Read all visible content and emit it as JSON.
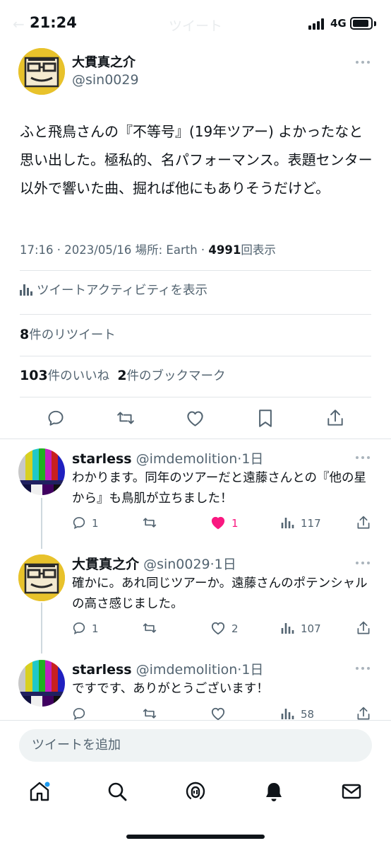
{
  "status_bar": {
    "time": "21:24",
    "network": "4G",
    "ghost_title": "ツイート"
  },
  "tweet": {
    "author_name": "大貫真之介",
    "author_handle": "@sin0029",
    "text": "ふと飛鳥さんの『不等号』(19年ツアー) よかったなと思い出した。極私的、名パフォーマンス。表題センター以外で響いた曲、掘れば他にもありそうだけど。",
    "meta_prefix": "17:16 · 2023/05/16 場所: Earth · ",
    "views": "4991",
    "views_label": "回表示",
    "activity_label": "ツイートアクティビティを表示",
    "retweets": "8",
    "retweets_label": "件のリツイート",
    "likes": "103",
    "likes_label": "件のいいね",
    "bookmarks": "2",
    "bookmarks_label": "件のブックマーク"
  },
  "replies": [
    {
      "name": "starless",
      "handle": "@imdemolition",
      "time": "·1日",
      "text": "わかります。同年のツアーだと遠藤さんとの『他の星から』も鳥肌が立ちました！",
      "reply_count": "1",
      "retweet_count": "",
      "like_count": "1",
      "view_count": "117",
      "liked": true
    },
    {
      "name": "大貫真之介",
      "handle": "@sin0029",
      "time": "·1日",
      "text": "確かに。あれ同じツアーか。遠藤さんのポテンシャルの高さ感じました。",
      "reply_count": "1",
      "retweet_count": "",
      "like_count": "2",
      "view_count": "107",
      "liked": false
    },
    {
      "name": "starless",
      "handle": "@imdemolition",
      "time": "·1日",
      "text": "ですです、ありがとうございます！",
      "reply_count": "",
      "retweet_count": "",
      "like_count": "",
      "view_count": "58",
      "liked": false
    }
  ],
  "compose": {
    "placeholder": "ツイートを追加"
  },
  "colors": {
    "like_active": "#f91880",
    "secondary_text": "#536471",
    "primary_text": "#0f1419"
  },
  "icons": {
    "tweet_actions": [
      "reply-icon",
      "retweet-icon",
      "like-icon",
      "bookmark-icon",
      "share-icon"
    ],
    "tab_bar": [
      "home-icon",
      "search-icon",
      "spaces-icon",
      "notifications-icon",
      "messages-icon"
    ]
  }
}
